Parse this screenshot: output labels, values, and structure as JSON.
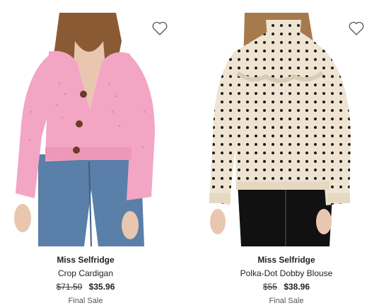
{
  "products": [
    {
      "brand": "Miss Selfridge",
      "name": "Crop Cardigan",
      "original_price": "$71.50",
      "sale_price": "$35.96",
      "tag": "Final Sale",
      "image_icon": "pink-cardigan-photo"
    },
    {
      "brand": "Miss Selfridge",
      "name": "Polka-Dot Dobby Blouse",
      "original_price": "$55",
      "sale_price": "$38.96",
      "tag": "Final Sale",
      "image_icon": "polka-dot-blouse-photo"
    }
  ],
  "wishlist_icon": "heart-outline-icon",
  "colors": {
    "text": "#222222",
    "muted": "#555555",
    "cardigan_pink": "#f3a6c3",
    "denim": "#5a7fa8",
    "blouse_cream": "#efe4d2"
  }
}
